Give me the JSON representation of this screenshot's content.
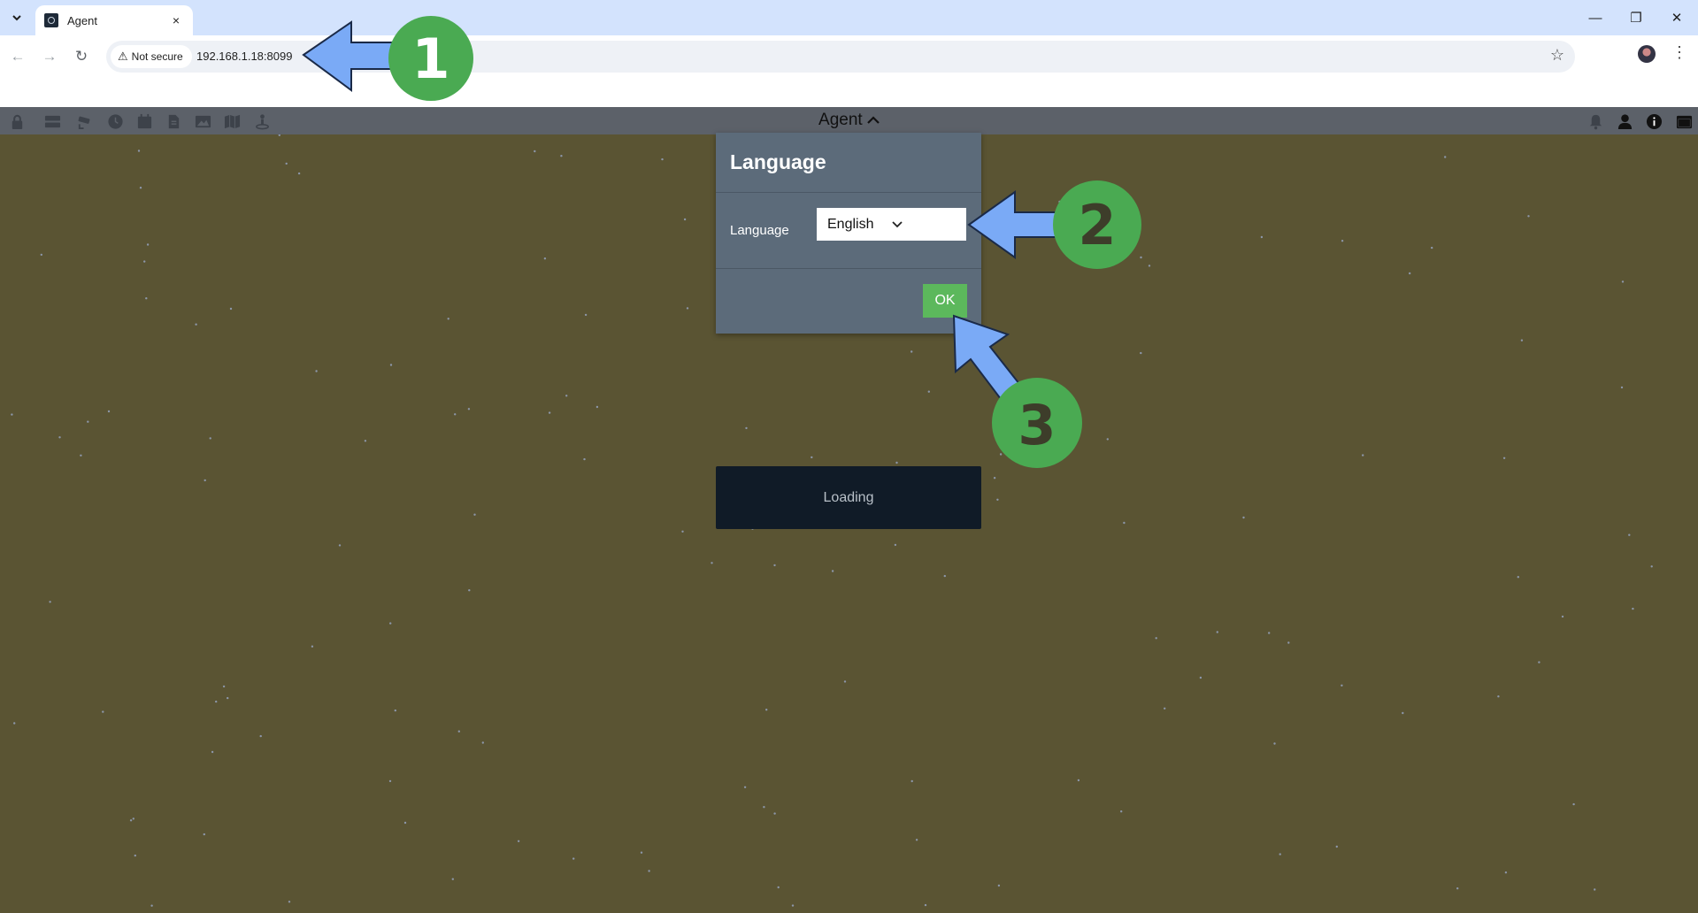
{
  "browser": {
    "tab": {
      "title": "Agent",
      "close_icon": "×"
    },
    "window_controls": {
      "minimize": "—",
      "restore": "❐",
      "close": "✕"
    },
    "nav": {
      "back": "←",
      "forward": "→",
      "reload": "↻"
    },
    "omnibox": {
      "security_label": "Not secure",
      "url": "192.168.1.18:8099"
    }
  },
  "app": {
    "title": "Agent",
    "left_icons": [
      "lock-icon",
      "server-icon",
      "camera-icon",
      "clock-icon",
      "calendar-icon",
      "file-icon",
      "image-icon",
      "map-icon",
      "person-pin-icon"
    ],
    "right_icons": [
      "bell-icon",
      "user-icon",
      "info-icon",
      "window-icon"
    ]
  },
  "dialog": {
    "title": "Language",
    "field_label": "Language",
    "selected_language": "English",
    "ok_label": "OK"
  },
  "loading": {
    "text": "Loading"
  },
  "annotations": {
    "markers": [
      "1",
      "2",
      "3"
    ],
    "arrow_color": "#7aaaf6",
    "marker_color": "#4aaa52"
  },
  "colors": {
    "background": "#5a5433",
    "header": "#5c6169",
    "dialog": "#5c6b7a",
    "ok_button": "#5cb85c",
    "loading_panel": "#101b27"
  }
}
